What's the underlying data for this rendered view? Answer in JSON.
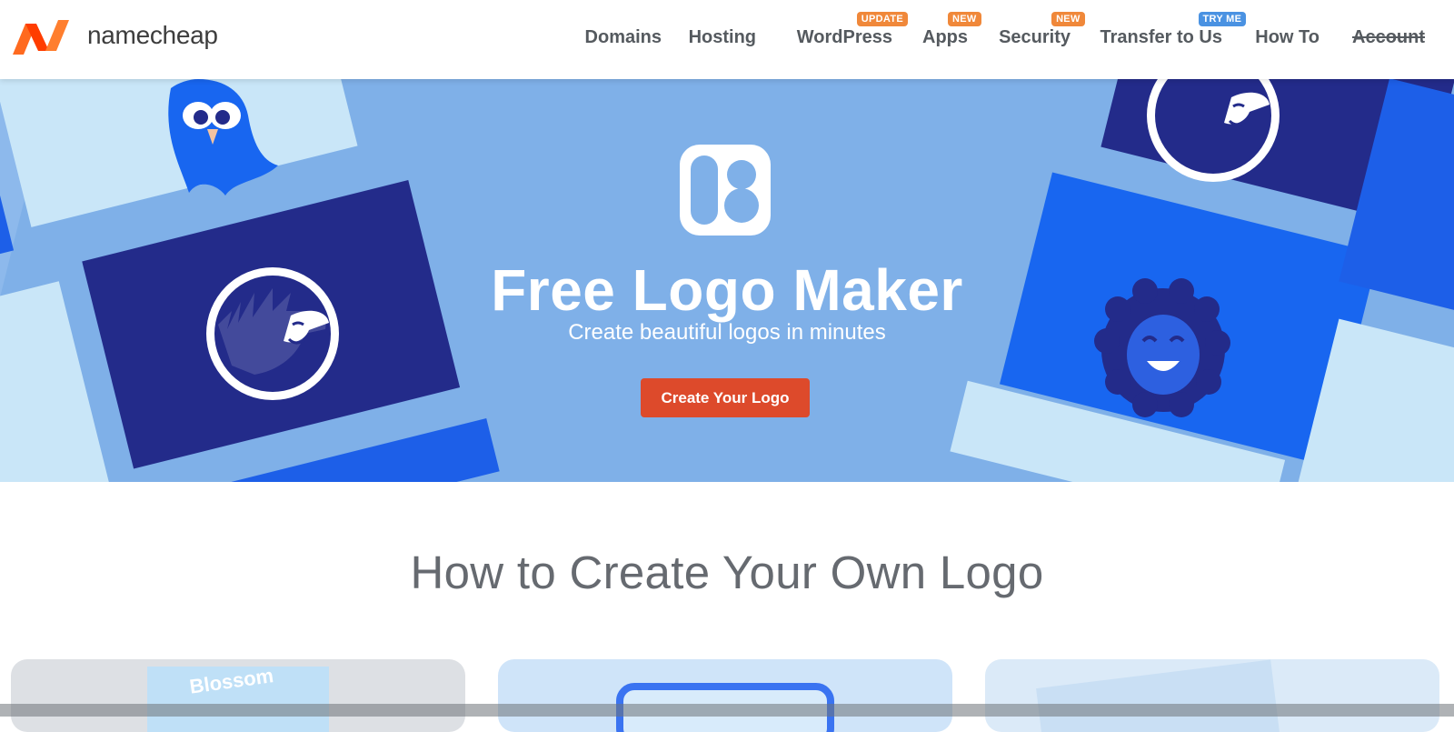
{
  "brand": {
    "name": "namecheap",
    "logo_colors": [
      "#ff6a1f",
      "#ff3d00"
    ]
  },
  "nav": {
    "items": [
      {
        "label": "Domains",
        "badge": null
      },
      {
        "label": "Hosting",
        "badge": null
      },
      {
        "label": "WordPress",
        "badge": "UPDATE",
        "badge_color": "#f0883a"
      },
      {
        "label": "Apps",
        "badge": "NEW",
        "badge_color": "#f0883a"
      },
      {
        "label": "Security",
        "badge": "NEW",
        "badge_color": "#f0883a"
      },
      {
        "label": "Transfer to Us",
        "badge": "TRY ME",
        "badge_color": "#4a92e2"
      },
      {
        "label": "How To",
        "badge": null
      },
      {
        "label": "Account",
        "badge": null
      }
    ]
  },
  "hero": {
    "title": "Free Logo Maker",
    "subtitle": "Create beautiful logos in minutes",
    "cta_label": "Create Your Logo",
    "background": "#7fb0e8",
    "cta_color": "#dd4a2b",
    "icons": [
      "bird-mascot-icon",
      "hedgehog-mascot-icon",
      "lion-mascot-icon",
      "logo-maker-app-icon"
    ]
  },
  "section": {
    "title": "How to Create Your Own Logo",
    "cards": [
      {
        "preview_text": "Blossom"
      },
      {
        "preview_text": ""
      },
      {
        "preview_text": ""
      }
    ]
  }
}
